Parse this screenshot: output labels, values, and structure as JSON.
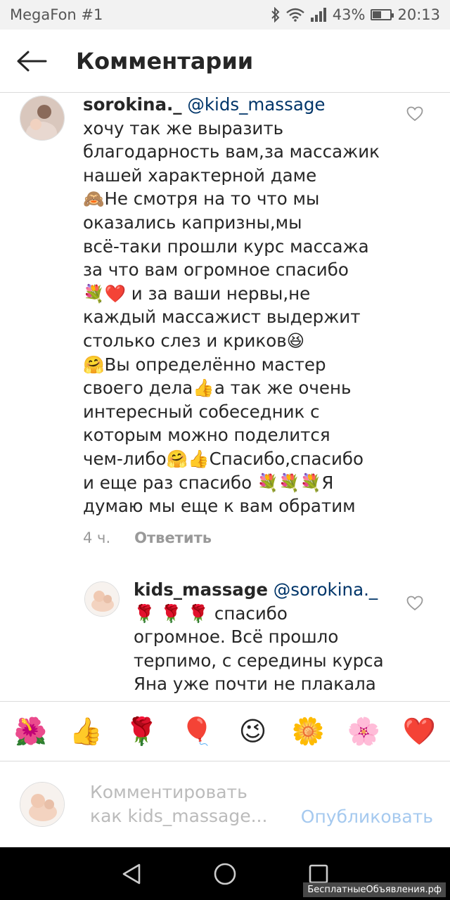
{
  "status_bar": {
    "carrier": "MegaFon #1",
    "battery": "43%",
    "battery_level": 0.43,
    "time": "20:13"
  },
  "header": {
    "title": "Комментарии"
  },
  "comments": [
    {
      "username": "sorokina._",
      "mention": "@kids_massage",
      "lines": [
        "хочу так же выразить",
        "благодарность вам,за массажик",
        "нашей характерной даме⁠",
        "🙈Не смотря на то что мы",
        "оказались капризны,мы",
        "всё-таки прошли курс массажа",
        "за что вам огромное спасибо",
        "💐❤️ и за ваши нервы,не",
        "каждый массажист выдержит",
        "столько слез и криков😆",
        "🤗Вы определённо мастер",
        "своего дела👍а так же очень",
        "интересный собеседник с",
        "которым можно поделится",
        "чем-либо🤗👍Спасибо,спасибо",
        "и еще раз спасибо 💐💐💐Я",
        "думаю мы еще к вам обратим"
      ],
      "time": "4 ч.",
      "reply_label": "Ответить"
    },
    {
      "username": "kids_massage",
      "mention": "@sorokina._",
      "lines": [
        "🌹 🌹 🌹  спасибо",
        "огромное. Всё прошло",
        "терпимо, с середины курса",
        "Яна уже почти не плакала"
      ]
    }
  ],
  "emoji_bar": [
    "🌺",
    "👍",
    "🌹",
    "🎈",
    "😉",
    "🌼",
    "🌸",
    "❤️"
  ],
  "composer": {
    "placeholder": "Комментировать как kids_massage...",
    "publish_label": "Опубликовать"
  },
  "watermark": "БесплатныеОбъявления.рф"
}
